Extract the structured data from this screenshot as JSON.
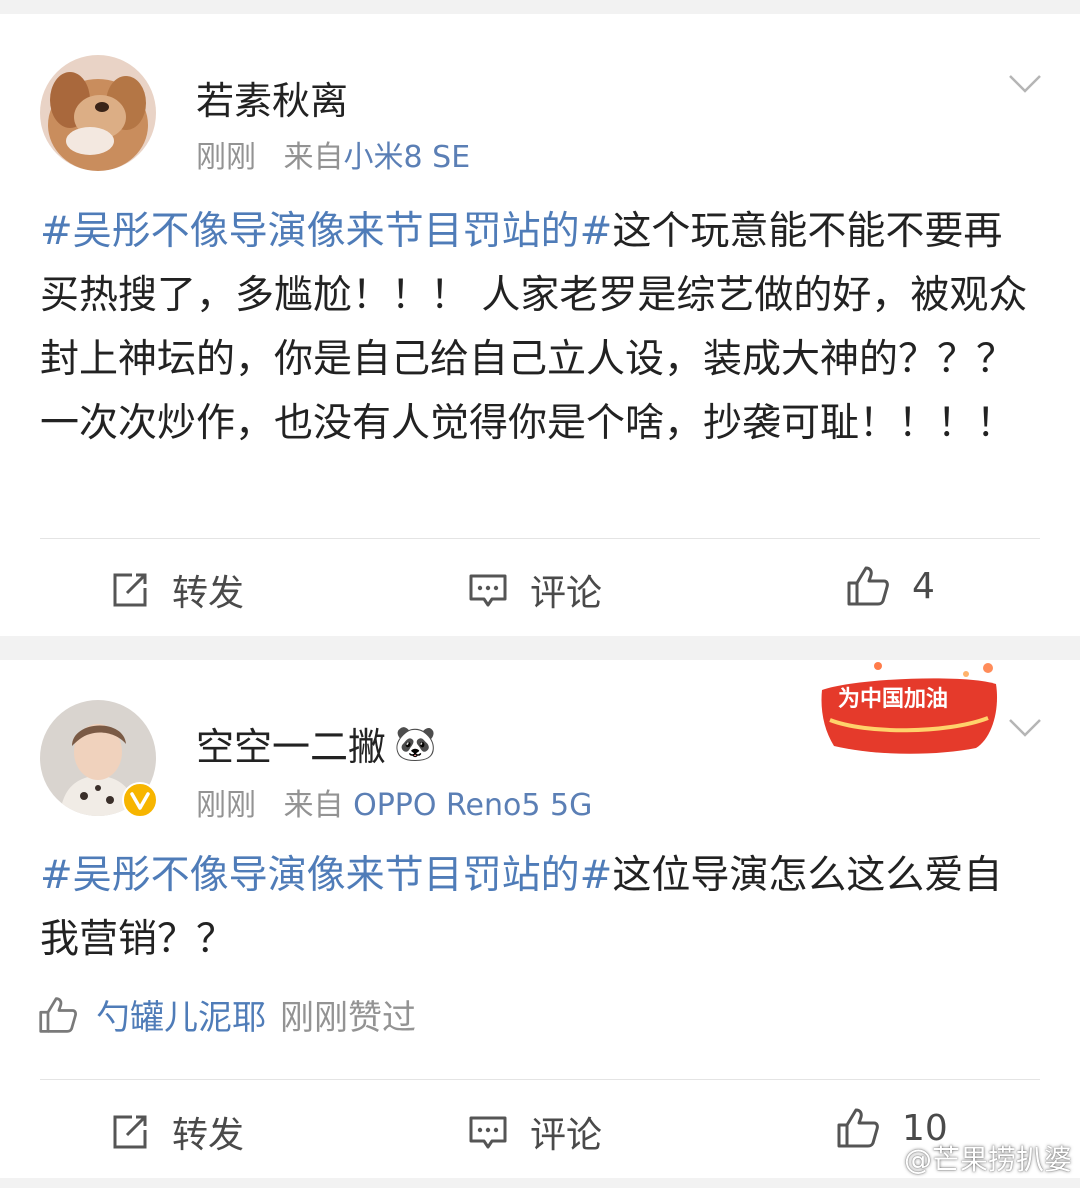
{
  "posts": [
    {
      "author": "若素秋离",
      "time": "刚刚",
      "source_prefix": "来自",
      "device": "小米8 SE",
      "hashtag": "#吴彤不像导演像来节目罚站的#",
      "body": "这个玩意能不能不要再买热搜了，多尴尬！！！ 人家老罗是综艺做的好，被观众封上神坛的，你是自己给自己立人设，装成大神的？？？ 一次次炒作，也没有人觉得你是个啥，抄袭可耻！！！！",
      "repost_label": "转发",
      "comment_label": "评论",
      "like_count": "4",
      "avatar_icon": "dog-avatar"
    },
    {
      "author": "空空一二撇",
      "author_emoji": "🐼",
      "time": "刚刚",
      "source_prefix": "来自",
      "device": "OPPO Reno5 5G",
      "hashtag": "#吴彤不像导演像来节目罚站的#",
      "body": "这位导演怎么这么爱自我营销？？",
      "liker": "勺罐儿泥耶",
      "liked_text": "刚刚赞过",
      "repost_label": "转发",
      "comment_label": "评论",
      "like_count": "10",
      "badge_text": "为中国加油",
      "verified_icon": "verified-v-icon"
    }
  ],
  "watermark": "@芒果捞扒婆",
  "colors": {
    "link": "#4f7cb8",
    "meta": "#939393",
    "text": "#222222",
    "badge_red": "#e53a2b"
  }
}
